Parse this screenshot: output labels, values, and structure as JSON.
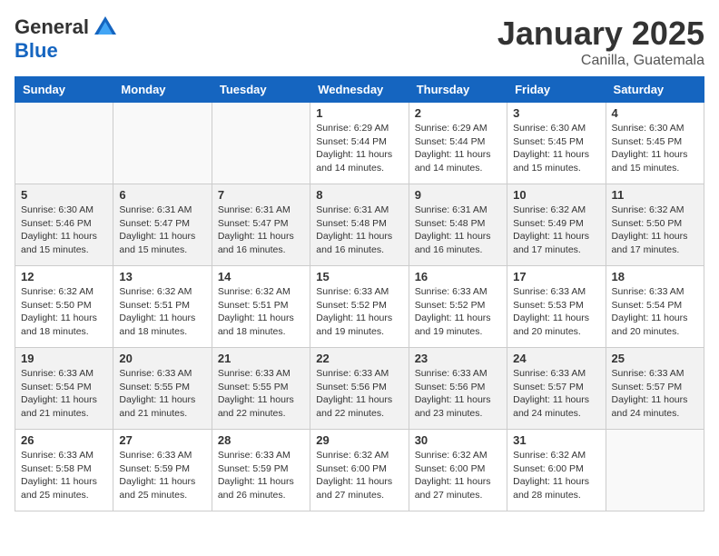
{
  "header": {
    "logo_general": "General",
    "logo_blue": "Blue",
    "title": "January 2025",
    "subtitle": "Canilla, Guatemala"
  },
  "weekdays": [
    "Sunday",
    "Monday",
    "Tuesday",
    "Wednesday",
    "Thursday",
    "Friday",
    "Saturday"
  ],
  "weeks": [
    [
      {
        "day": "",
        "info": ""
      },
      {
        "day": "",
        "info": ""
      },
      {
        "day": "",
        "info": ""
      },
      {
        "day": "1",
        "info": "Sunrise: 6:29 AM\nSunset: 5:44 PM\nDaylight: 11 hours\nand 14 minutes."
      },
      {
        "day": "2",
        "info": "Sunrise: 6:29 AM\nSunset: 5:44 PM\nDaylight: 11 hours\nand 14 minutes."
      },
      {
        "day": "3",
        "info": "Sunrise: 6:30 AM\nSunset: 5:45 PM\nDaylight: 11 hours\nand 15 minutes."
      },
      {
        "day": "4",
        "info": "Sunrise: 6:30 AM\nSunset: 5:45 PM\nDaylight: 11 hours\nand 15 minutes."
      }
    ],
    [
      {
        "day": "5",
        "info": "Sunrise: 6:30 AM\nSunset: 5:46 PM\nDaylight: 11 hours\nand 15 minutes."
      },
      {
        "day": "6",
        "info": "Sunrise: 6:31 AM\nSunset: 5:47 PM\nDaylight: 11 hours\nand 15 minutes."
      },
      {
        "day": "7",
        "info": "Sunrise: 6:31 AM\nSunset: 5:47 PM\nDaylight: 11 hours\nand 16 minutes."
      },
      {
        "day": "8",
        "info": "Sunrise: 6:31 AM\nSunset: 5:48 PM\nDaylight: 11 hours\nand 16 minutes."
      },
      {
        "day": "9",
        "info": "Sunrise: 6:31 AM\nSunset: 5:48 PM\nDaylight: 11 hours\nand 16 minutes."
      },
      {
        "day": "10",
        "info": "Sunrise: 6:32 AM\nSunset: 5:49 PM\nDaylight: 11 hours\nand 17 minutes."
      },
      {
        "day": "11",
        "info": "Sunrise: 6:32 AM\nSunset: 5:50 PM\nDaylight: 11 hours\nand 17 minutes."
      }
    ],
    [
      {
        "day": "12",
        "info": "Sunrise: 6:32 AM\nSunset: 5:50 PM\nDaylight: 11 hours\nand 18 minutes."
      },
      {
        "day": "13",
        "info": "Sunrise: 6:32 AM\nSunset: 5:51 PM\nDaylight: 11 hours\nand 18 minutes."
      },
      {
        "day": "14",
        "info": "Sunrise: 6:32 AM\nSunset: 5:51 PM\nDaylight: 11 hours\nand 18 minutes."
      },
      {
        "day": "15",
        "info": "Sunrise: 6:33 AM\nSunset: 5:52 PM\nDaylight: 11 hours\nand 19 minutes."
      },
      {
        "day": "16",
        "info": "Sunrise: 6:33 AM\nSunset: 5:52 PM\nDaylight: 11 hours\nand 19 minutes."
      },
      {
        "day": "17",
        "info": "Sunrise: 6:33 AM\nSunset: 5:53 PM\nDaylight: 11 hours\nand 20 minutes."
      },
      {
        "day": "18",
        "info": "Sunrise: 6:33 AM\nSunset: 5:54 PM\nDaylight: 11 hours\nand 20 minutes."
      }
    ],
    [
      {
        "day": "19",
        "info": "Sunrise: 6:33 AM\nSunset: 5:54 PM\nDaylight: 11 hours\nand 21 minutes."
      },
      {
        "day": "20",
        "info": "Sunrise: 6:33 AM\nSunset: 5:55 PM\nDaylight: 11 hours\nand 21 minutes."
      },
      {
        "day": "21",
        "info": "Sunrise: 6:33 AM\nSunset: 5:55 PM\nDaylight: 11 hours\nand 22 minutes."
      },
      {
        "day": "22",
        "info": "Sunrise: 6:33 AM\nSunset: 5:56 PM\nDaylight: 11 hours\nand 22 minutes."
      },
      {
        "day": "23",
        "info": "Sunrise: 6:33 AM\nSunset: 5:56 PM\nDaylight: 11 hours\nand 23 minutes."
      },
      {
        "day": "24",
        "info": "Sunrise: 6:33 AM\nSunset: 5:57 PM\nDaylight: 11 hours\nand 24 minutes."
      },
      {
        "day": "25",
        "info": "Sunrise: 6:33 AM\nSunset: 5:57 PM\nDaylight: 11 hours\nand 24 minutes."
      }
    ],
    [
      {
        "day": "26",
        "info": "Sunrise: 6:33 AM\nSunset: 5:58 PM\nDaylight: 11 hours\nand 25 minutes."
      },
      {
        "day": "27",
        "info": "Sunrise: 6:33 AM\nSunset: 5:59 PM\nDaylight: 11 hours\nand 25 minutes."
      },
      {
        "day": "28",
        "info": "Sunrise: 6:33 AM\nSunset: 5:59 PM\nDaylight: 11 hours\nand 26 minutes."
      },
      {
        "day": "29",
        "info": "Sunrise: 6:32 AM\nSunset: 6:00 PM\nDaylight: 11 hours\nand 27 minutes."
      },
      {
        "day": "30",
        "info": "Sunrise: 6:32 AM\nSunset: 6:00 PM\nDaylight: 11 hours\nand 27 minutes."
      },
      {
        "day": "31",
        "info": "Sunrise: 6:32 AM\nSunset: 6:00 PM\nDaylight: 11 hours\nand 28 minutes."
      },
      {
        "day": "",
        "info": ""
      }
    ]
  ]
}
